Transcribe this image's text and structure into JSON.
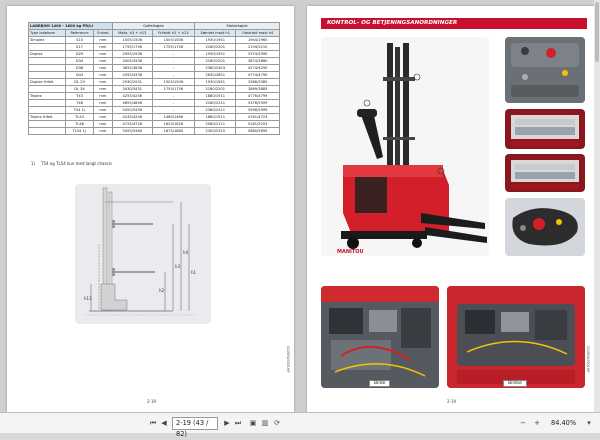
{
  "left_page": {
    "table": {
      "title": "LADEBOM 1400 - 1600 kg PR/LI",
      "col_group_1": "Gaffelhøjde",
      "col_group_2": "Stablehøjde",
      "head": [
        "Type ladebom",
        "Reference",
        "Enhed",
        "Maks. h3 + h13",
        "Frifeldt h2 + h13",
        "Sænket mast h1",
        "Udstrakt mast h4"
      ],
      "rows": [
        {
          "type": "Simplex",
          "ref": "S15",
          "unit": "mm",
          "h3": "1505/1506",
          "h2": "1505/1506",
          "h1": "1930/1951",
          "h4": "1944/1960"
        },
        {
          "type": "",
          "ref": "S17",
          "unit": "mm",
          "h3": "1755/1756",
          "h2": "1755/1756",
          "h1": "2180/2201",
          "h4": "2194/2210"
        },
        {
          "type": "Duplex",
          "ref": "D29",
          "unit": "mm",
          "h3": "2955/2936",
          "h2": "-",
          "h1": "1930/1951",
          "h4": "3374/3390"
        },
        {
          "type": "",
          "ref": "D34",
          "unit": "mm",
          "h3": "3405/3436",
          "h2": "-",
          "h1": "2180/2201",
          "h4": "3874/3880"
        },
        {
          "type": "",
          "ref": "D38",
          "unit": "mm",
          "h3": "3855/3836",
          "h2": "-",
          "h1": "2380/2403",
          "h4": "4274/4290"
        },
        {
          "type": "",
          "ref": "D43",
          "unit": "mm",
          "h3": "4355/4336",
          "h2": "-",
          "h1": "2630/2651",
          "h4": "4774/4790"
        },
        {
          "type": "Duplex frifelt",
          "ref": "DL 29",
          "unit": "mm",
          "h3": "2930/2931",
          "h2": "1505/1506",
          "h1": "1930/1951",
          "h4": "3368/3385"
        },
        {
          "type": "",
          "ref": "DL 34",
          "unit": "mm",
          "h3": "3430/3431",
          "h2": "1755/1756",
          "h1": "2180/2201",
          "h4": "3869/3885"
        },
        {
          "type": "Triplex",
          "ref": "T43",
          "unit": "mm",
          "h3": "4255/4256",
          "h2": "-",
          "h1": "1880/1911",
          "h4": "4776/4799"
        },
        {
          "type": "",
          "ref": "T48",
          "unit": "mm",
          "h3": "4655/4856",
          "h2": "-",
          "h1": "2180/2211",
          "h4": "5376/5399"
        },
        {
          "type": "",
          "ref": "T54 1)",
          "unit": "mm",
          "h3": "5455/5456",
          "h2": "-",
          "h1": "2380/2411",
          "h4": "5998/5999"
        },
        {
          "type": "Triplex frifelt",
          "ref": "TL43",
          "unit": "mm",
          "h3": "4245/4246",
          "h2": "1460/1466",
          "h1": "1880/1911",
          "h4": "4761/4723"
        },
        {
          "type": "",
          "ref": "TL48",
          "unit": "mm",
          "h3": "4725/4726",
          "h2": "1625/1626",
          "h1": "2080/2111",
          "h4": "5181/5203"
        },
        {
          "type": "",
          "ref": "TL54 1)",
          "unit": "mm",
          "h3": "5455/5460",
          "h2": "1875/1880",
          "h1": "2300/2315",
          "h4": "5880/5895"
        }
      ]
    },
    "footnote_num": "1)",
    "footnote_text": "T54 og TL54 kun med langt chassis",
    "diagram_labels": [
      "h4",
      "h3",
      "h2",
      "h1",
      "h13"
    ],
    "page_number": "2-19",
    "side_code": "0118EN/3001MP"
  },
  "right_page": {
    "section_title": "KONTROL- OG BETJENINGSANORDNINGER",
    "brand": "MANITOU",
    "photo_label_1": "Bilde",
    "photo_label_2": "Bildse",
    "page_number": "2-19",
    "side_code": "0118EN/3001MP"
  },
  "toolbar": {
    "page_indicator": "2-19 (43 / 82)",
    "zoom": "84.40%"
  }
}
